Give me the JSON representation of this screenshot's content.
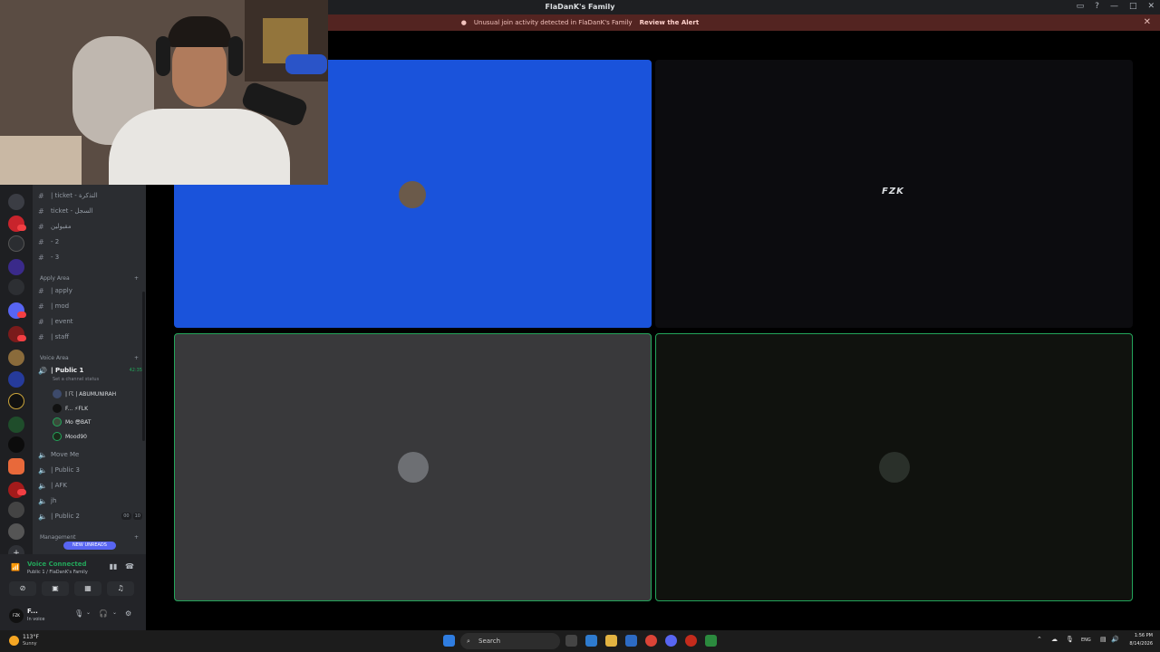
{
  "window": {
    "title": "FlaDanK's Family"
  },
  "alert": {
    "message": "Unusual join activity detected in FlaDanK's Family",
    "action": "Review the Alert"
  },
  "channels": {
    "top_items": [
      {
        "label": "| ticket - التذكرة"
      },
      {
        "label": "ticket - السجل"
      },
      {
        "label": "مقبولين"
      },
      {
        "label": "- 2"
      },
      {
        "label": "- 3"
      }
    ],
    "apply_category": "Apply Area",
    "apply_items": [
      {
        "label": "| apply"
      },
      {
        "label": "| mod"
      },
      {
        "label": "| event"
      },
      {
        "label": "| staff"
      }
    ],
    "voice_category": "Voice Area",
    "active_voice": {
      "label": "| Public 1",
      "timer": "42:35",
      "status_hint": "Set a channel status"
    },
    "voice_users": [
      {
        "name": "| ☈ | ABUMUNIRAH"
      },
      {
        "name": "F... ⚡FLK"
      },
      {
        "name": "Mo 😎BAT"
      },
      {
        "name": "Mood90"
      }
    ],
    "other_voice": [
      {
        "label": "Move Me"
      },
      {
        "label": "| Public 3"
      },
      {
        "label": "| AFK"
      },
      {
        "label": "jh"
      },
      {
        "label": "| Public 2",
        "count_a": "00",
        "count_b": "10"
      }
    ],
    "management_category": "Management",
    "new_unreads": "NEW UNREADS"
  },
  "voice_panel": {
    "title": "Voice Connected",
    "subtitle": "Public 1 / FlaDanK's Family"
  },
  "user_panel": {
    "name": "F...",
    "status": "In voice",
    "avatar_text": "FZK"
  },
  "tiles": {
    "tile2_name": "FZK"
  },
  "taskbar": {
    "weather_temp": "113°F",
    "weather_desc": "Sunny",
    "search": "Search",
    "lang": "ENG",
    "time": "1:56 PM",
    "date": "8/14/2026"
  },
  "colors": {
    "accent": "#5865f2",
    "voice_green": "#23a55a",
    "tile_blue": "#1a53db",
    "alert_bg": "#532421"
  }
}
